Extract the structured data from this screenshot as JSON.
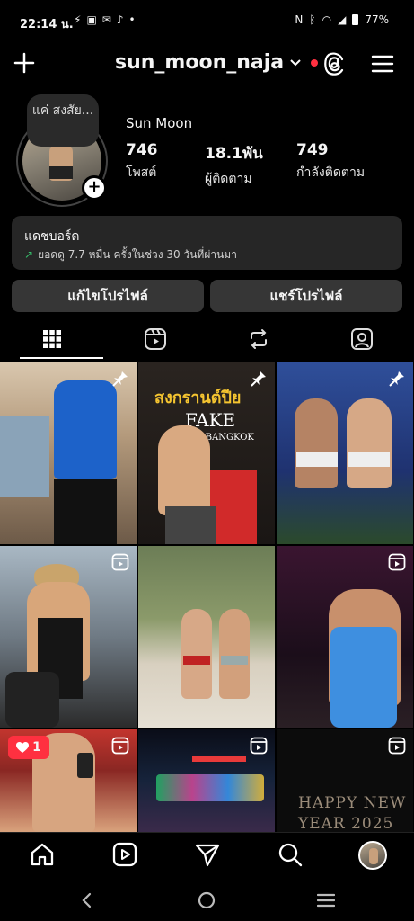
{
  "status_bar": {
    "time": "22:14 น.",
    "battery": "77%"
  },
  "header": {
    "username": "sun_moon_naja"
  },
  "profile": {
    "note": "แค่ สงสัย...",
    "display_name": "Sun Moon",
    "stats": [
      {
        "value": "746",
        "label": "โพสต์"
      },
      {
        "value": "18.1พัน",
        "label": "ผู้ติดตาม"
      },
      {
        "value": "749",
        "label": "กำลังติดตาม"
      }
    ]
  },
  "dashboard": {
    "title": "แดชบอร์ด",
    "subtitle": "ยอดดู 7.7 หมื่น ครั้งในช่วง 30 วันที่ผ่านมา"
  },
  "buttons": {
    "edit_profile": "แก้ไขโปรไฟล์",
    "share_profile": "แชร์โปรไฟล์"
  },
  "tabs": [
    {
      "name": "grid-icon"
    },
    {
      "name": "reels-icon"
    },
    {
      "name": "repost-icon"
    },
    {
      "name": "tagged-icon"
    }
  ],
  "grid": {
    "post2_sign_line1": "สงกรานต์ปีย",
    "post2_sign_line2": "FAKE",
    "post2_sign_line3": "CLUB BANGKOK",
    "post9_text_line1": "HAPPY NEW",
    "post9_text_line2": "YEAR 2025",
    "like_count": "1"
  },
  "colors": {
    "background": "#000000",
    "card": "#262626",
    "button": "#363636",
    "accent_red": "#ff3040",
    "trend_green": "#36c26c"
  }
}
